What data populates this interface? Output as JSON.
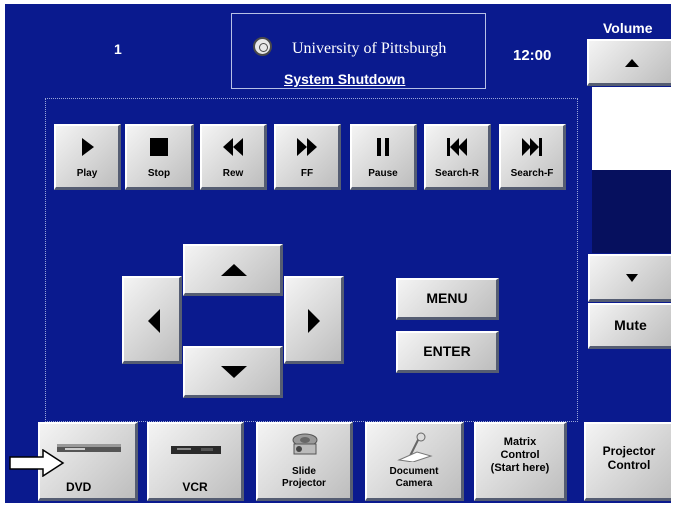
{
  "header": {
    "room_number": "1",
    "university": "University of Pittsburgh",
    "shutdown": "System Shutdown",
    "clock": "12:00"
  },
  "volume": {
    "label": "Volume",
    "level": 0.5,
    "mute_label": "Mute"
  },
  "transport": [
    {
      "id": "play",
      "label": "Play",
      "icon": "play-icon"
    },
    {
      "id": "stop",
      "label": "Stop",
      "icon": "stop-icon"
    },
    {
      "id": "rew",
      "label": "Rew",
      "icon": "rewind-icon"
    },
    {
      "id": "ff",
      "label": "FF",
      "icon": "fast-forward-icon"
    },
    {
      "id": "pause",
      "label": "Pause",
      "icon": "pause-icon"
    },
    {
      "id": "search-r",
      "label": "Search-R",
      "icon": "skip-back-icon"
    },
    {
      "id": "search-f",
      "label": "Search-F",
      "icon": "skip-forward-icon"
    }
  ],
  "menu_label": "MENU",
  "enter_label": "ENTER",
  "sources": [
    {
      "id": "dvd",
      "label": "DVD",
      "icon": "dvd-player-icon"
    },
    {
      "id": "vcr",
      "label": "VCR",
      "icon": "vcr-icon"
    },
    {
      "id": "slide",
      "label": "Slide\nProjector",
      "icon": "slide-projector-icon"
    },
    {
      "id": "doc-cam",
      "label": "Document\nCamera",
      "icon": "document-camera-icon"
    },
    {
      "id": "matrix",
      "label": "Matrix\nControl\n(Start here)",
      "icon": ""
    },
    {
      "id": "projector",
      "label": "Projector\nControl",
      "icon": ""
    }
  ],
  "colors": {
    "panel": "#0a1a8e",
    "button": "#d6d6d6",
    "text": "#ffffff"
  }
}
